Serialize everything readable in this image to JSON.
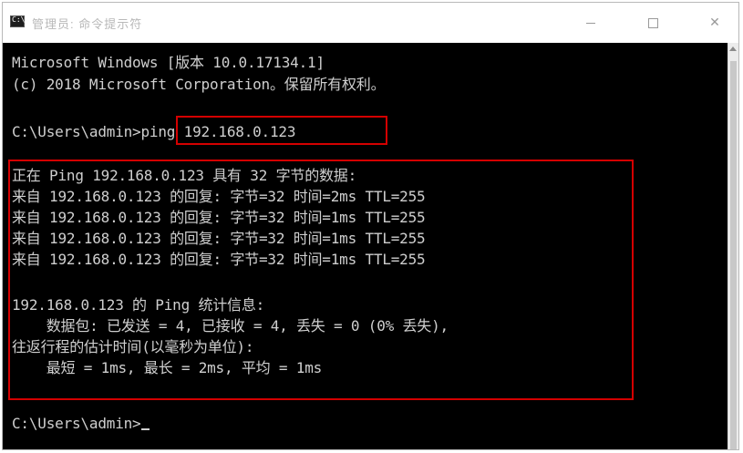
{
  "window": {
    "title": "管理员: 命令提示符",
    "app_icon": "cmd-icon",
    "controls": {
      "minimize_icon": "minimize-icon",
      "maximize_icon": "maximize-icon",
      "close_icon": "close-icon",
      "close_glyph": "✕"
    }
  },
  "colors": {
    "console_bg": "#000000",
    "console_text": "#cccccc",
    "highlight": "#d40000"
  },
  "console": {
    "header": [
      "Microsoft Windows [版本 10.0.17134.1]",
      "(c) 2018 Microsoft Corporation。保留所有权利。"
    ],
    "prompt": "C:\\Users\\admin>",
    "command": "ping 192.168.0.123",
    "output": [
      "正在 Ping 192.168.0.123 具有 32 字节的数据:",
      "来自 192.168.0.123 的回复: 字节=32 时间=2ms TTL=255",
      "来自 192.168.0.123 的回复: 字节=32 时间=1ms TTL=255",
      "来自 192.168.0.123 的回复: 字节=32 时间=1ms TTL=255",
      "来自 192.168.0.123 的回复: 字节=32 时间=1ms TTL=255",
      "",
      "192.168.0.123 的 Ping 统计信息:",
      "    数据包: 已发送 = 4, 已接收 = 4, 丢失 = 0 (0% 丢失),",
      "往返行程的估计时间(以毫秒为单位):",
      "    最短 = 1ms, 最长 = 2ms, 平均 = 1ms"
    ],
    "final_prompt": "C:\\Users\\admin>"
  }
}
